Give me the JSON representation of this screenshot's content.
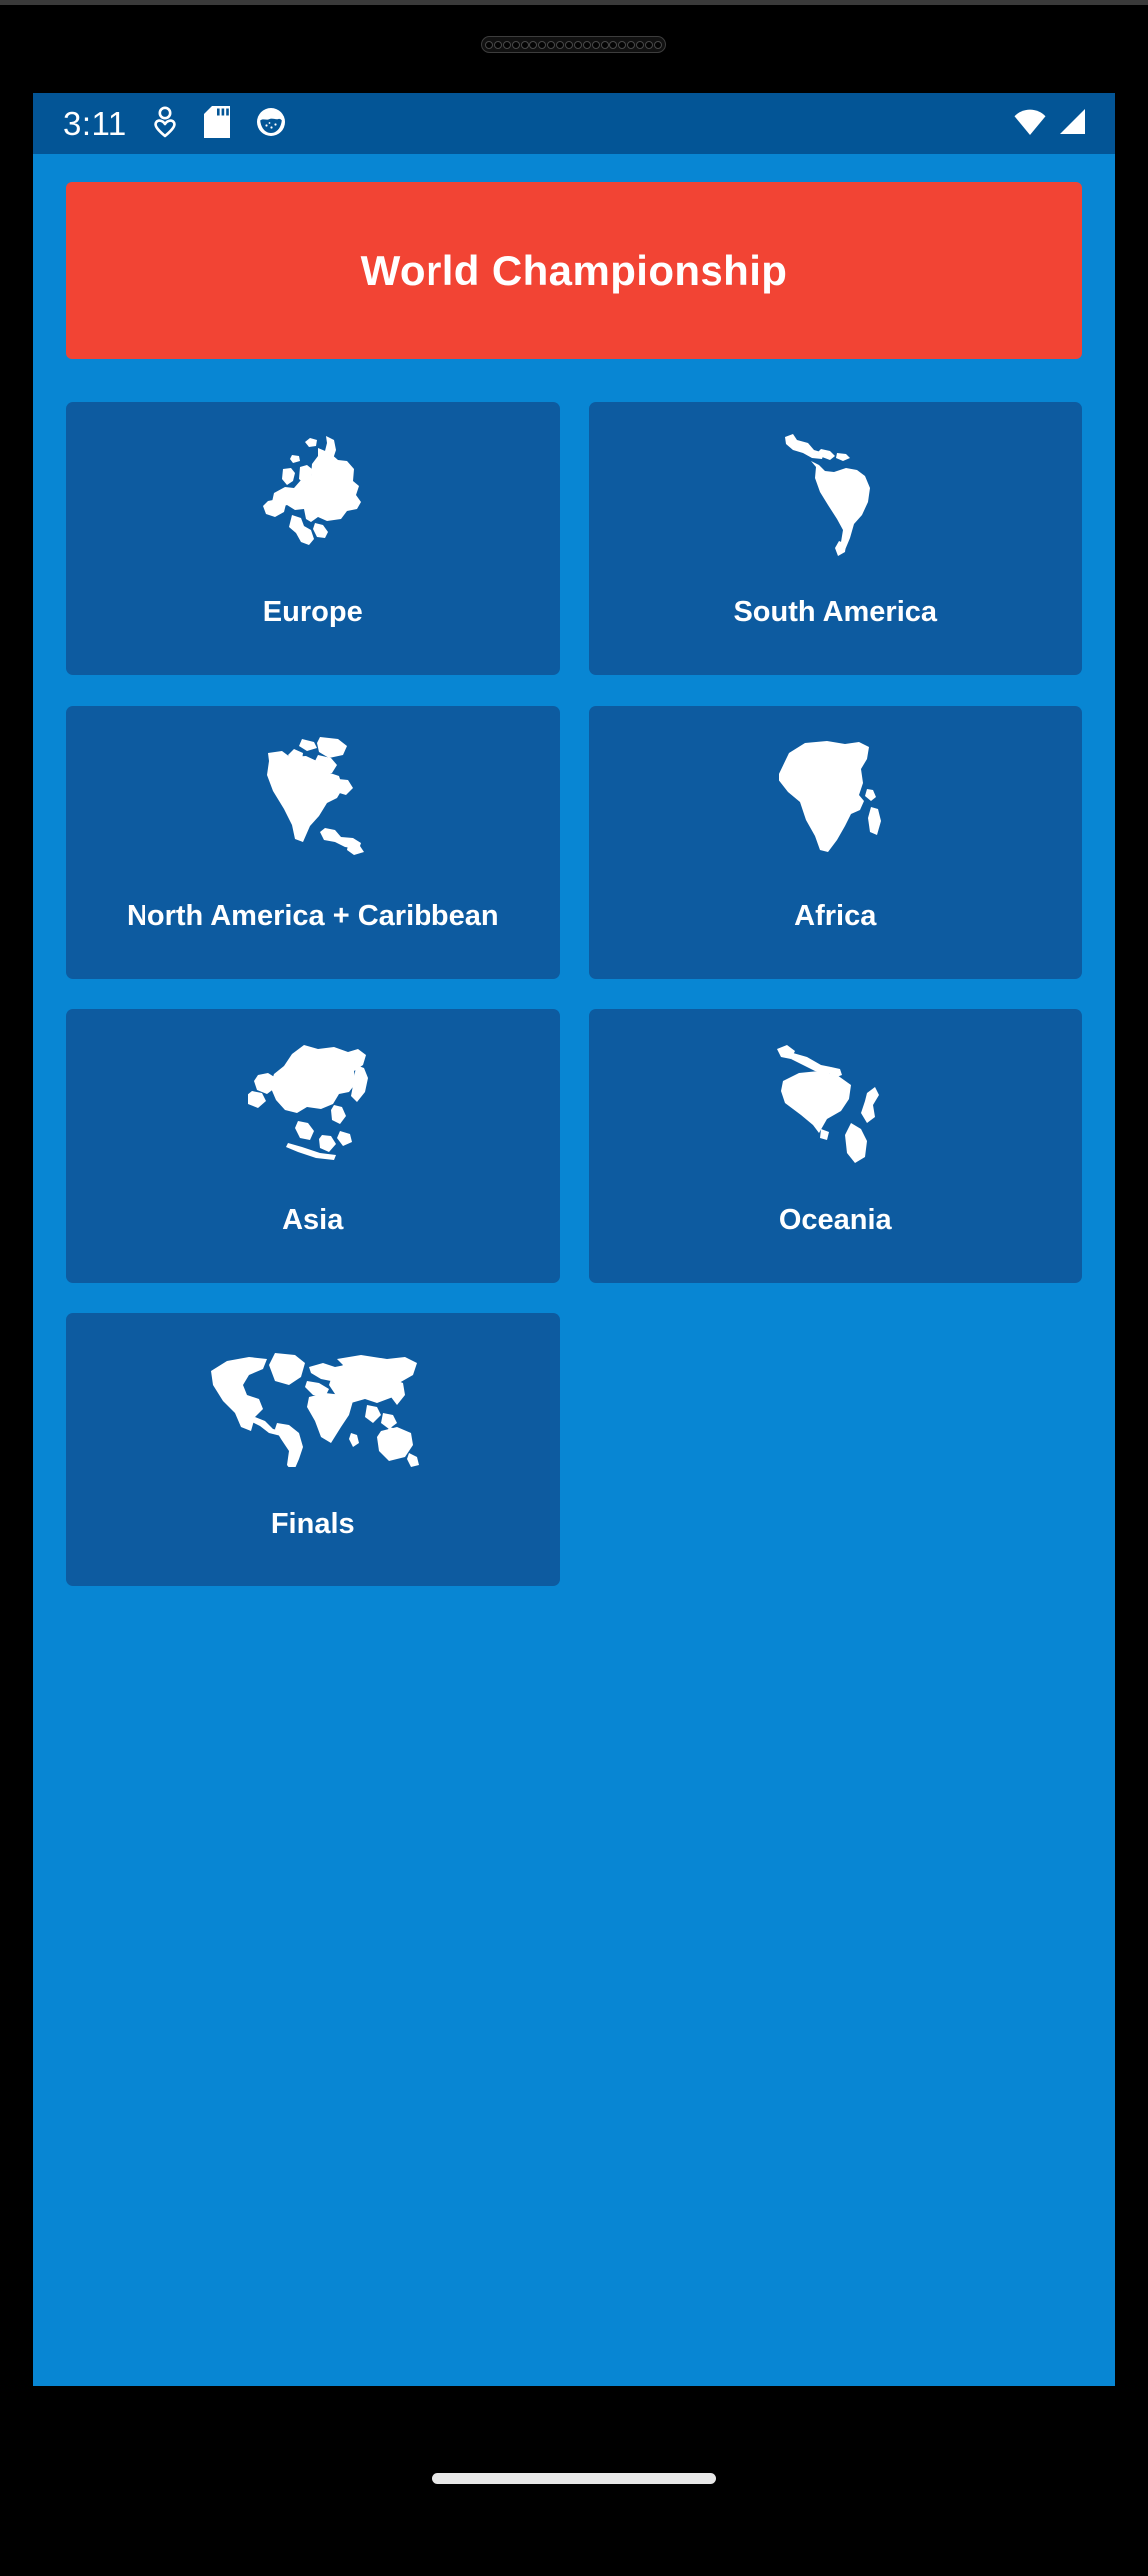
{
  "statusbar": {
    "time": "3:11",
    "notification_icons": [
      "person-heart-icon",
      "sd-card-icon",
      "app-badge-icon"
    ],
    "system_icons": [
      "wifi-icon",
      "cellular-signal-icon"
    ]
  },
  "header": {
    "title": "World Championship",
    "background_color": "#f24434",
    "text_color": "#ffffff"
  },
  "theme": {
    "screen_background": "#0886d3",
    "card_background": "#0d5ba0",
    "statusbar_background": "#035596",
    "accent": "#f24434",
    "map_fill": "#ffffff"
  },
  "grid": {
    "cards": [
      {
        "label": "Europe",
        "icon": "europe-map-icon"
      },
      {
        "label": "South America",
        "icon": "south-america-map-icon"
      },
      {
        "label": "North America + Caribbean",
        "icon": "north-america-map-icon"
      },
      {
        "label": "Africa",
        "icon": "africa-map-icon"
      },
      {
        "label": "Asia",
        "icon": "asia-map-icon"
      },
      {
        "label": "Oceania",
        "icon": "oceania-map-icon"
      },
      {
        "label": "Finals",
        "icon": "world-map-icon"
      }
    ]
  },
  "navigation": {
    "home_indicator": "gesture-home-bar"
  }
}
